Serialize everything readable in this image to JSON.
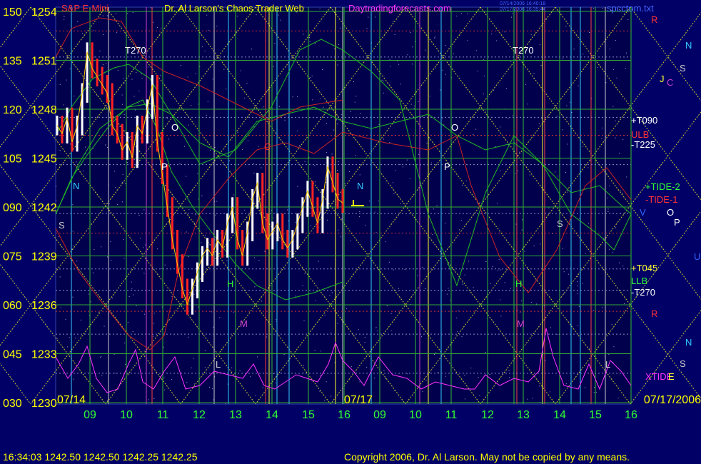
{
  "header": {
    "symbol": "S&P E-Mini",
    "title": "Dr. Al Larson's Chaos Trader Web",
    "site": "Daytradingforecasts.com",
    "stamp1": "07/14/2006 16:40:18",
    "stamp2": "07/17/2006 16:35:44",
    "file": "spcctom.txt"
  },
  "footer": {
    "quote": "16:34:03  1242.50  1242.50  1242.25  1242.25",
    "copyright": "Copyright 2006, Dr. Al Larson. May not be copied by any means."
  },
  "chart_data": {
    "type": "line",
    "yaxis_left": [
      "150",
      "135",
      "120",
      "105",
      "090",
      "075",
      "060",
      "045",
      "030"
    ],
    "yaxis_price": [
      "1254",
      "1251",
      "1248",
      "1245",
      "1242",
      "1239",
      "1236",
      "1233",
      "1230"
    ],
    "ylim": [
      1230,
      1254
    ],
    "xaxis_hours": [
      "09",
      "10",
      "11",
      "12",
      "13",
      "14",
      "15",
      "16",
      "09",
      "10",
      "11",
      "12",
      "13",
      "14",
      "15",
      "16"
    ],
    "dates": [
      "07/14",
      "07/17",
      "07/17/2006"
    ],
    "price_07_14": [
      1247,
      1246.5,
      1247.5,
      1246,
      1247,
      1249,
      1251.5,
      1250.5,
      1250,
      1249.5,
      1249,
      1247,
      1246.5,
      1245.5,
      1246,
      1245,
      1247,
      1246.5,
      1248,
      1249.5,
      1246,
      1244,
      1242,
      1240,
      1238.5,
      1237,
      1236,
      1237,
      1238,
      1239,
      1239.5,
      1239,
      1240,
      1239.5,
      1241,
      1242,
      1240,
      1239,
      1240.5,
      1242.5,
      1243.5,
      1241,
      1240,
      1240.5,
      1241,
      1240,
      1239.5,
      1240,
      1241,
      1242,
      1243,
      1242,
      1241,
      1242.5,
      1244.5,
      1243.5,
      1242.5,
      1242.25
    ],
    "annotations": [
      "T270",
      "O",
      "P",
      "N",
      "S",
      "C",
      "H",
      "M",
      "L",
      "T270",
      "O",
      "P",
      "N",
      "S",
      "H",
      "M",
      "L"
    ],
    "right_labels": [
      "R",
      "N",
      "S",
      "J",
      "C",
      "+T090",
      "ULB",
      "-T225",
      "+TIDE-2",
      "-TIDE-1",
      "V",
      "O",
      "P",
      "U",
      "+T045",
      "LLB",
      "-T270",
      "R",
      "N",
      "S",
      "XTIDE",
      "E"
    ],
    "colors": {
      "background": "#000066",
      "grid_yellow": "#cccc33",
      "grid_green": "#33bb33",
      "price_up": "#ffffff",
      "price_down": "#ff2222",
      "tide": "#22bb22",
      "xtide": "#ff33ff",
      "red_line": "#cc2222"
    }
  }
}
